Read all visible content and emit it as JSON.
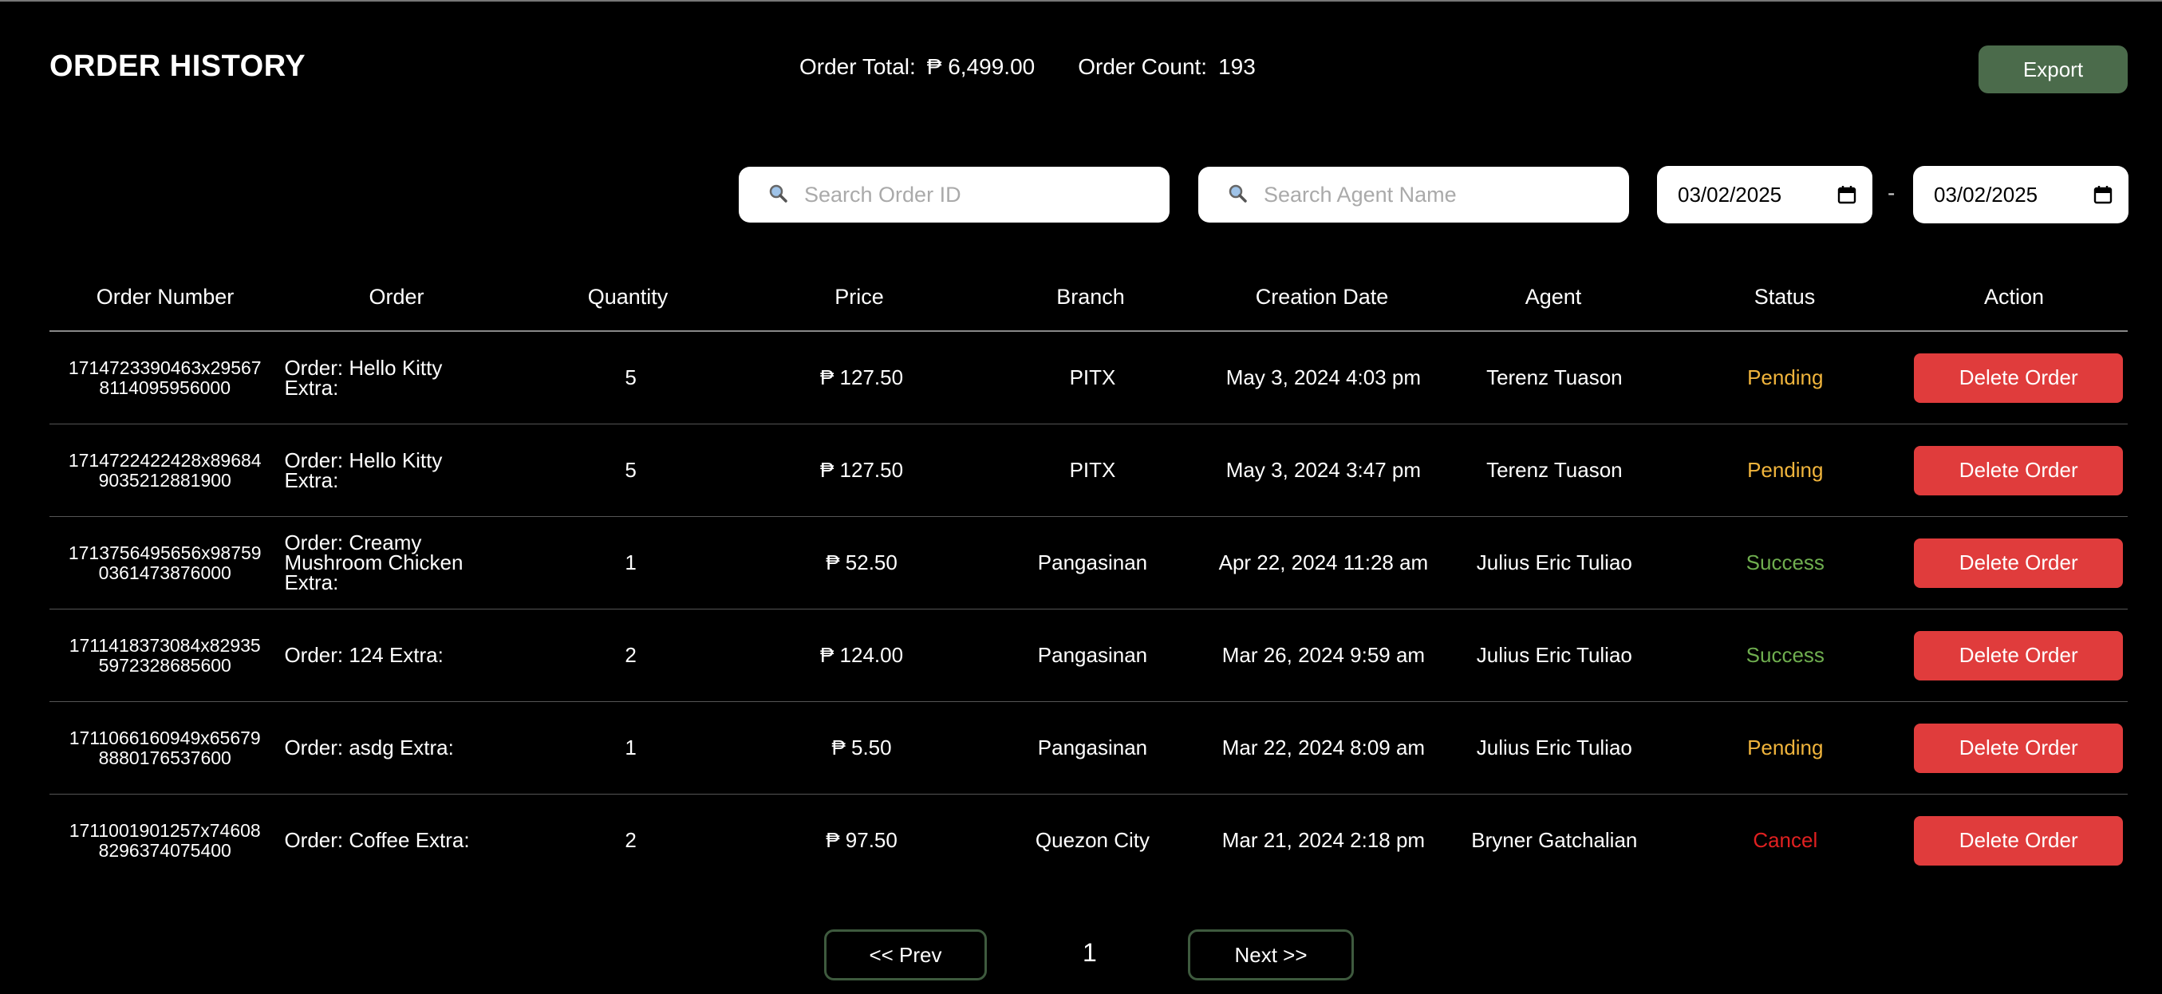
{
  "header": {
    "title": "ORDER HISTORY",
    "order_total_label": "Order Total:",
    "order_total_value": "₱ 6,499.00",
    "order_count_label": "Order Count:",
    "order_count_value": "193",
    "export_label": "Export"
  },
  "filters": {
    "search_order_placeholder": "Search Order ID",
    "search_agent_placeholder": "Search Agent Name",
    "date_from": "03/02/2025",
    "date_separator": "-",
    "date_to": "03/02/2025"
  },
  "table": {
    "columns": [
      "Order Number",
      "Order",
      "Quantity",
      "Price",
      "Branch",
      "Creation Date",
      "Agent",
      "Status",
      "Action"
    ],
    "rows": [
      {
        "order_number": "1714723390463x29567\n8114095956000",
        "order": "Order: Hello Kitty\n Extra:",
        "quantity": "5",
        "price": "₱ 127.50",
        "branch": "PITX",
        "date": "May 3, 2024 4:03 pm",
        "agent": "Terenz Tuason",
        "status": "Pending",
        "action": "Delete Order"
      },
      {
        "order_number": "1714722422428x89684\n9035212881900",
        "order": "Order: Hello Kitty\n Extra:",
        "quantity": "5",
        "price": "₱ 127.50",
        "branch": "PITX",
        "date": "May 3, 2024 3:47 pm",
        "agent": "Terenz Tuason",
        "status": "Pending",
        "action": "Delete Order"
      },
      {
        "order_number": "1713756495656x98759\n0361473876000",
        "order": "Order: Creamy\nMushroom Chicken\n Extra:",
        "quantity": "1",
        "price": "₱ 52.50",
        "branch": "Pangasinan",
        "date": "Apr 22, 2024 11:28 am",
        "agent": "Julius Eric Tuliao",
        "status": "Success",
        "action": "Delete Order"
      },
      {
        "order_number": "1711418373084x82935\n5972328685600",
        "order": "Order: 124  Extra:",
        "quantity": "2",
        "price": "₱ 124.00",
        "branch": "Pangasinan",
        "date": "Mar 26, 2024 9:59 am",
        "agent": "Julius Eric Tuliao",
        "status": "Success",
        "action": "Delete Order"
      },
      {
        "order_number": "1711066160949x65679\n8880176537600",
        "order": "Order: asdg  Extra:",
        "quantity": "1",
        "price": "₱ 5.50",
        "branch": "Pangasinan",
        "date": "Mar 22, 2024 8:09 am",
        "agent": "Julius Eric Tuliao",
        "status": "Pending",
        "action": "Delete Order"
      },
      {
        "order_number": "1711001901257x74608\n8296374075400",
        "order": "Order: Coffee  Extra:",
        "quantity": "2",
        "price": "₱ 97.50",
        "branch": "Quezon City",
        "date": "Mar 21, 2024 2:18 pm",
        "agent": "Bryner Gatchalian",
        "status": "Cancel",
        "action": "Delete Order"
      }
    ]
  },
  "pagination": {
    "prev_label": "<< Prev",
    "page": "1",
    "next_label": "Next >>"
  },
  "colors": {
    "export_button": "#4b6b4b",
    "delete_button": "#e03c3c",
    "pending": "#f0b43c",
    "success": "#6fae4f",
    "cancel": "#e02020"
  },
  "icons": {
    "search": "search-icon",
    "calendar": "calendar-icon"
  }
}
